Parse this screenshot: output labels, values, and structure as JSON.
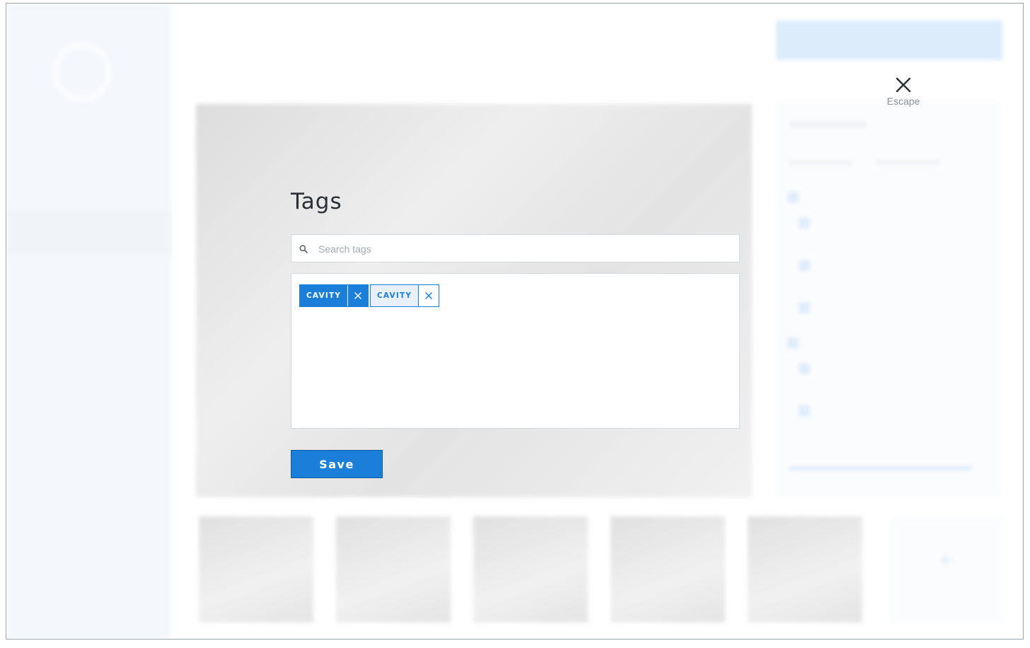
{
  "escape": {
    "label": "Escape",
    "icon": "close-icon"
  },
  "modal": {
    "title": "Tags",
    "search": {
      "placeholder": "Search tags",
      "value": "",
      "icon": "search-icon"
    },
    "tags": [
      {
        "label": "CAVITY",
        "style": "filled",
        "remove_icon": "close-icon"
      },
      {
        "label": "CAVITY",
        "style": "outline",
        "remove_icon": "close-icon"
      }
    ],
    "save_label": "Save"
  },
  "colors": {
    "accent": "#1b7fd9",
    "sidebar_bg": "#dde9f8",
    "border": "#d3d8dd"
  }
}
